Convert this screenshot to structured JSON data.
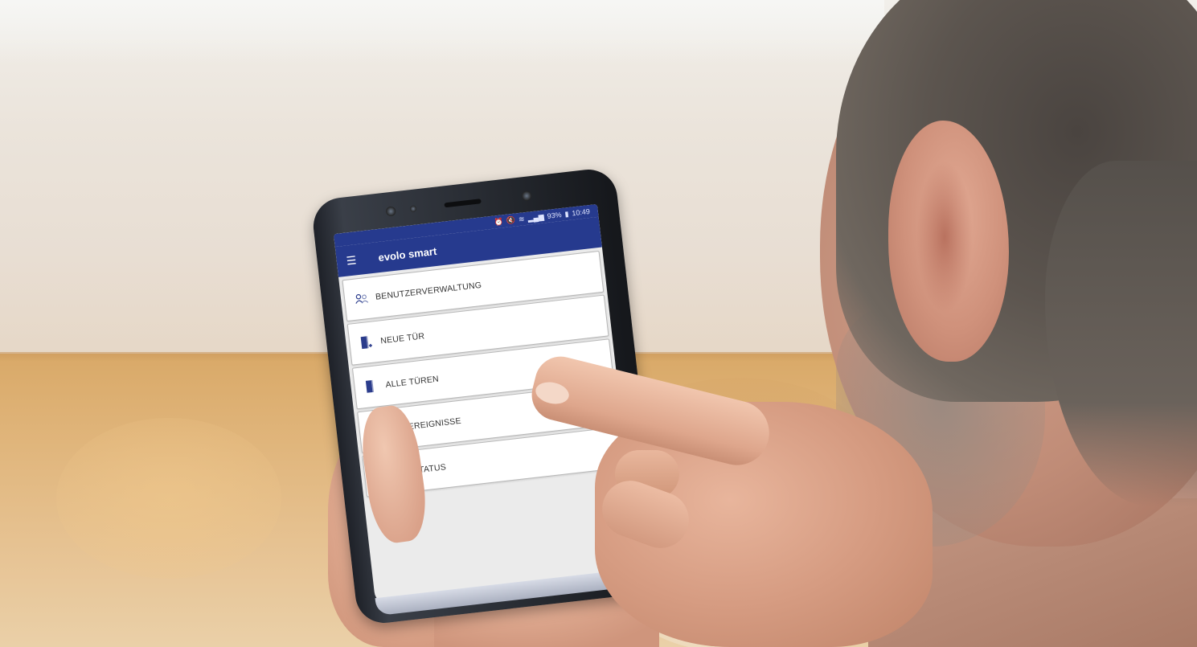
{
  "phone": {
    "status": {
      "battery": "93%",
      "time": "10:49"
    },
    "app_title": "evolo smart",
    "menu": [
      {
        "label": "BENUTZERVERWALTUNG",
        "icon": "users-icon"
      },
      {
        "label": "NEUE TÜR",
        "icon": "door-add-icon"
      },
      {
        "label": "ALLE TÜREN",
        "icon": "door-icon"
      },
      {
        "label": "TÜREREIGNISSE",
        "icon": "door-events-icon"
      },
      {
        "label": "TÜRSTATUS",
        "icon": "door-status-icon"
      }
    ]
  },
  "colors": {
    "app_bar": "#263a8e",
    "icon_blue": "#2b3c8c",
    "card_bg": "#ffffff",
    "screen_bg": "#ebebeb"
  }
}
